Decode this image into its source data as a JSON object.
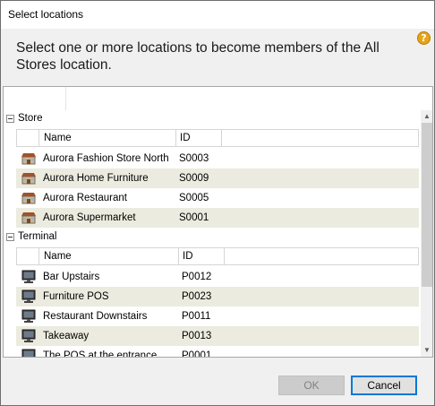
{
  "window": {
    "title": "Select locations"
  },
  "header": {
    "instruction": "Select one or more locations to become members of the All Stores location.",
    "help_glyph": "?"
  },
  "groups": [
    {
      "label": "Store",
      "columns": [
        "Name",
        "ID"
      ],
      "rows": [
        {
          "name": "Aurora Fashion Store North",
          "id": "S0003",
          "icon": "store-icon"
        },
        {
          "name": "Aurora Home Furniture",
          "id": "S0009",
          "icon": "store-icon"
        },
        {
          "name": "Aurora Restaurant",
          "id": "S0005",
          "icon": "store-icon"
        },
        {
          "name": "Aurora Supermarket",
          "id": "S0001",
          "icon": "store-icon"
        }
      ]
    },
    {
      "label": "Terminal",
      "columns": [
        "Name",
        "ID"
      ],
      "rows": [
        {
          "name": "Bar Upstairs",
          "id": "P0012",
          "icon": "terminal-icon"
        },
        {
          "name": "Furniture POS",
          "id": "P0023",
          "icon": "terminal-icon"
        },
        {
          "name": "Restaurant Downstairs",
          "id": "P0011",
          "icon": "terminal-icon"
        },
        {
          "name": "Takeaway",
          "id": "P0013",
          "icon": "terminal-icon"
        },
        {
          "name": "The POS at the entrance",
          "id": "P0001",
          "icon": "terminal-icon"
        }
      ]
    }
  ],
  "buttons": {
    "ok": "OK",
    "cancel": "Cancel"
  },
  "colors": {
    "alt_row": "#ebebdf",
    "accent": "#0078d7",
    "help": "#e8a317"
  }
}
